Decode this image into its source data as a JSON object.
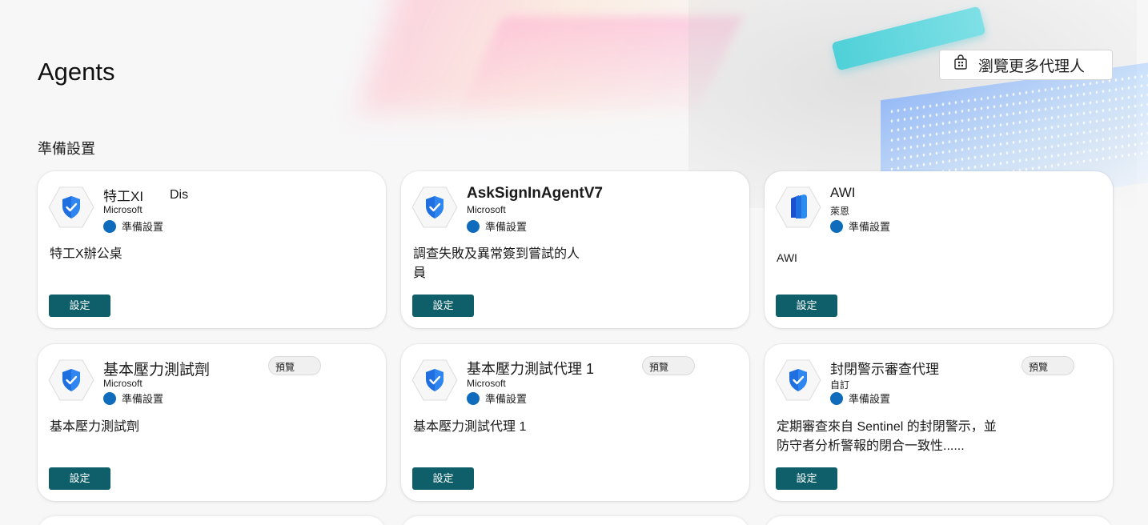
{
  "page": {
    "title": "Agents",
    "browse_label": "瀏覽更多代理人",
    "section_title": "準備設置"
  },
  "colors": {
    "accent_button": "#0e5f6a",
    "status_dot": "#0f6cbd",
    "shield_blue": "#1f6fe0"
  },
  "cards": [
    {
      "name": "特工XI",
      "extra": "Dis",
      "publisher": "Microsoft",
      "status": "準備設置",
      "description": "特工X辦公桌",
      "setup_label": "設定",
      "icon": "shield-check-icon"
    },
    {
      "name": "AskSignInAgentV7",
      "publisher": "Microsoft",
      "status": "準備設置",
      "description": "調查失敗及異常簽到嘗試的人員",
      "setup_label": "設定",
      "icon": "shield-check-icon"
    },
    {
      "name": "AWI",
      "publisher": "萊恩",
      "status": "準備設置",
      "description": "AWI",
      "setup_label": "設定",
      "icon": "document-icon"
    },
    {
      "name": "基本壓力測試劑",
      "badge": "預覽",
      "publisher": "Microsoft",
      "status": "準備設置",
      "description": "基本壓力測試劑",
      "setup_label": "設定",
      "icon": "shield-check-icon"
    },
    {
      "name": "基本壓力測試代理 1",
      "badge": "預覽",
      "publisher": "Microsoft",
      "status": "準備設置",
      "description": "基本壓力測試代理 1",
      "setup_label": "設定",
      "icon": "shield-check-icon"
    },
    {
      "name": "封閉警示審查代理",
      "badge": "預覽",
      "publisher": "自訂",
      "status": "準備設置",
      "description": "定期審查來自 Sentinel 的封閉警示，並防守者分析警報的閉合一致性......",
      "setup_label": "設定",
      "icon": "shield-check-icon"
    }
  ]
}
